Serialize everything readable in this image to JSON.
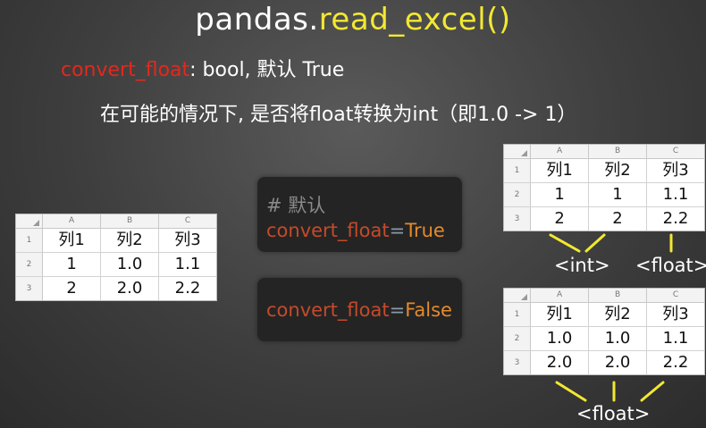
{
  "title": {
    "prefix": "pandas.",
    "func": "read_excel()"
  },
  "param": {
    "name": "convert_float",
    "rest": ": bool, 默认 True"
  },
  "description": "在可能的情况下, 是否将float转换为int（即1.0 -> 1）",
  "sheets": {
    "source": {
      "col_headers": [
        "A",
        "B",
        "C"
      ],
      "rows": [
        {
          "num": "1",
          "cells": [
            "列1",
            "列2",
            "列3"
          ]
        },
        {
          "num": "2",
          "cells": [
            "1",
            "1.0",
            "1.1"
          ]
        },
        {
          "num": "3",
          "cells": [
            "2",
            "2.0",
            "2.2"
          ]
        }
      ]
    },
    "result_true": {
      "col_headers": [
        "A",
        "B",
        "C"
      ],
      "rows": [
        {
          "num": "1",
          "cells": [
            "列1",
            "列2",
            "列3"
          ]
        },
        {
          "num": "2",
          "cells": [
            "1",
            "1",
            "1.1"
          ]
        },
        {
          "num": "3",
          "cells": [
            "2",
            "2",
            "2.2"
          ]
        }
      ]
    },
    "result_false": {
      "col_headers": [
        "A",
        "B",
        "C"
      ],
      "rows": [
        {
          "num": "1",
          "cells": [
            "列1",
            "列2",
            "列3"
          ]
        },
        {
          "num": "2",
          "cells": [
            "1.0",
            "1.0",
            "1.1"
          ]
        },
        {
          "num": "3",
          "cells": [
            "2.0",
            "2.0",
            "2.2"
          ]
        }
      ]
    }
  },
  "code_true": {
    "comment": "# 默认",
    "keyword": "convert_float",
    "eq": "=",
    "value": "True"
  },
  "code_false": {
    "keyword": "convert_float",
    "eq": "=",
    "value": "False"
  },
  "labels": {
    "int": "<int>",
    "float_top": "<float>",
    "float_bottom": "<float>"
  },
  "colors": {
    "highlight": "#f2e832",
    "param_name": "#e3281c",
    "arrow": "#f2e832",
    "code_keyword": "#c54a2a",
    "code_value": "#e58a2c"
  }
}
